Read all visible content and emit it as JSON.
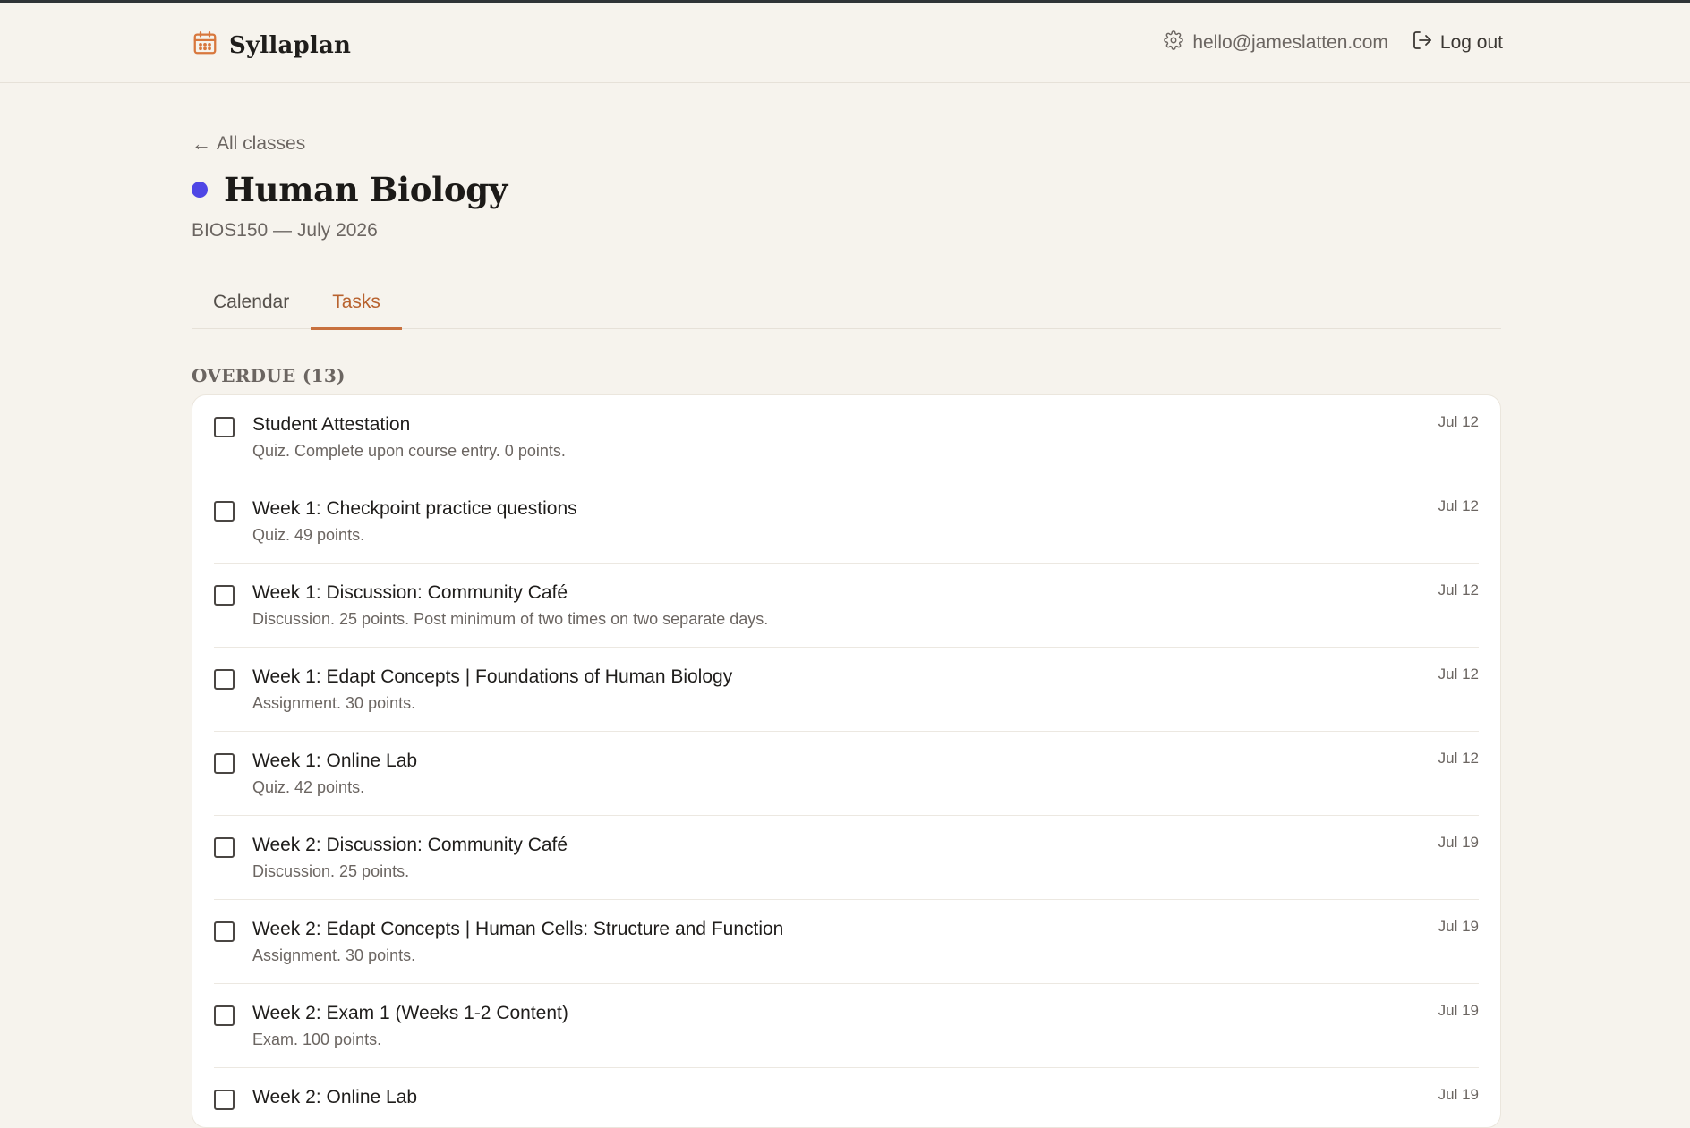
{
  "app": {
    "name": "Syllaplan",
    "brand_color": "#d8773d"
  },
  "account": {
    "email": "hello@jameslatten.com",
    "logout_label": "Log out"
  },
  "nav": {
    "back_label": "All classes"
  },
  "course": {
    "title": "Human Biology",
    "subtitle": "BIOS150 — July 2026",
    "color": "#4f46e5"
  },
  "tabs": [
    {
      "label": "Calendar",
      "active": false
    },
    {
      "label": "Tasks",
      "active": true
    }
  ],
  "overdue": {
    "heading": "OVERDUE (13)",
    "tasks": [
      {
        "name": "Student Attestation",
        "desc": "Quiz. Complete upon course entry. 0 points.",
        "date": "Jul 12",
        "done": false
      },
      {
        "name": "Week 1: Checkpoint practice questions",
        "desc": "Quiz. 49 points.",
        "date": "Jul 12",
        "done": false
      },
      {
        "name": "Week 1: Discussion: Community Café",
        "desc": "Discussion. 25 points. Post minimum of two times on two separate days.",
        "date": "Jul 12",
        "done": false
      },
      {
        "name": "Week 1: Edapt Concepts | Foundations of Human Biology",
        "desc": "Assignment. 30 points.",
        "date": "Jul 12",
        "done": false
      },
      {
        "name": "Week 1: Online Lab",
        "desc": "Quiz. 42 points.",
        "date": "Jul 12",
        "done": false
      },
      {
        "name": "Week 2: Discussion: Community Café",
        "desc": "Discussion. 25 points.",
        "date": "Jul 19",
        "done": false
      },
      {
        "name": "Week 2: Edapt Concepts | Human Cells: Structure and Function",
        "desc": "Assignment. 30 points.",
        "date": "Jul 19",
        "done": false
      },
      {
        "name": "Week 2: Exam 1 (Weeks 1-2 Content)",
        "desc": "Exam. 100 points.",
        "date": "Jul 19",
        "done": false
      },
      {
        "name": "Week 2: Online Lab",
        "desc": "",
        "date": "Jul 19",
        "done": false
      }
    ]
  },
  "icons": {
    "brand": "calendar-icon",
    "account": "gear-icon",
    "logout": "logout-icon",
    "back": "arrow-left-icon"
  }
}
